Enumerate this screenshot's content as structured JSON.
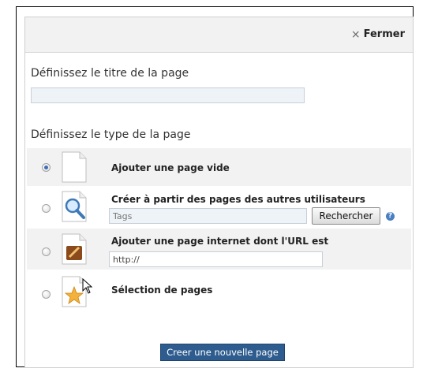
{
  "dialog": {
    "close": {
      "label": "Fermer",
      "icon": "close-icon"
    }
  },
  "title_section": {
    "label": "Définissez le titre de la page",
    "input_value": ""
  },
  "type_section": {
    "label": "Définissez le type de la page",
    "options": [
      {
        "label": "Ajouter une page vide",
        "selected": true,
        "icon": "blank-page-icon"
      },
      {
        "label": "Créer à partir des pages des autres utilisateurs",
        "selected": false,
        "icon": "magnifier-page-icon",
        "tags_placeholder": "Tags",
        "search_button": "Rechercher",
        "help_icon": "help-icon"
      },
      {
        "label": "Ajouter une page internet dont l'URL est",
        "selected": false,
        "icon": "web-page-icon",
        "url_value": "http://"
      },
      {
        "label": "Sélection de pages",
        "selected": false,
        "icon": "star-page-icon"
      }
    ]
  },
  "footer": {
    "create_button": "Creer une nouvelle page"
  },
  "colors": {
    "accent": "#2e5c8e",
    "radio_selected": "#3d6fb3",
    "row_alt": "#f2f2f2"
  }
}
